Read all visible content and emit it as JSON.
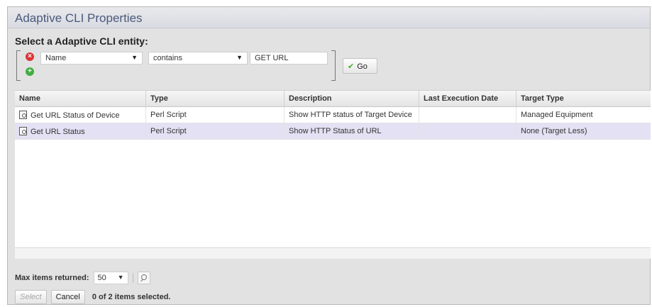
{
  "window": {
    "title": "Adaptive CLI Properties"
  },
  "selector": {
    "label": "Select a Adaptive CLI entity:"
  },
  "filter": {
    "field": "Name",
    "operator": "contains",
    "value": "GET URL",
    "go_label": "Go"
  },
  "table": {
    "columns": [
      "Name",
      "Type",
      "Description",
      "Last Execution Date",
      "Target Type"
    ],
    "rows": [
      {
        "name": "Get URL Status of Device",
        "type": "Perl Script",
        "description": "Show HTTP status of Target Device",
        "last_execution": "",
        "target_type": "Managed Equipment"
      },
      {
        "name": "Get URL Status",
        "type": "Perl Script",
        "description": "Show HTTP Status of URL",
        "last_execution": "",
        "target_type": "None (Target Less)"
      }
    ]
  },
  "footer": {
    "max_items_label": "Max items returned:",
    "max_items_value": "50",
    "select_label": "Select",
    "cancel_label": "Cancel",
    "selection_status": "0 of 2 items selected."
  },
  "icons": {
    "remove": "remove-filter-icon",
    "add": "add-filter-icon",
    "go": "checkmark-icon",
    "row": "document-search-icon",
    "search": "search-icon"
  },
  "colors": {
    "selected_row": "#e3e1f3",
    "title": "#4a5a7a",
    "remove": "#d93636",
    "add": "#3fae3f"
  }
}
